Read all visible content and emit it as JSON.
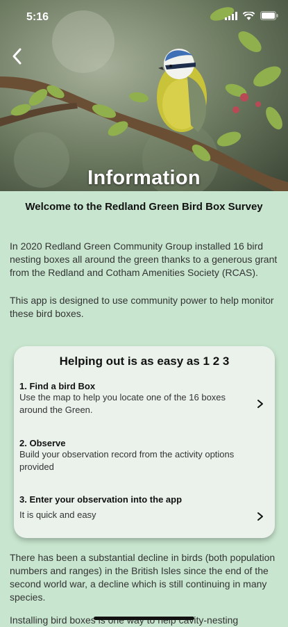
{
  "status_bar": {
    "time": "5:16"
  },
  "hero": {
    "title": "Information"
  },
  "intro": {
    "heading": "Welcome to the Redland Green Bird Box Survey",
    "paragraph1": "In 2020 Redland Green Community Group installed 16 bird nesting boxes all around the green thanks to a generous grant from the Redland and Cotham Amenities Society (RCAS).",
    "paragraph2": "This app is designed to use community power to help monitor these bird boxes."
  },
  "card": {
    "title": "Helping out is as easy as 1 2 3",
    "steps": [
      {
        "title": "1. Find a bird Box",
        "text": "Use the map to help you locate one of the 16 boxes around the Green."
      },
      {
        "title": "2. Observe",
        "text": "Build your observation record from the activity options provided"
      },
      {
        "title": "3. Enter your observation into the app",
        "text": "It is quick and easy"
      }
    ]
  },
  "body": {
    "paragraph3": "There has been a substantial decline in birds (both population numbers and ranges) in the British Isles since the end of the second world war, a decline which is still continuing in many species.",
    "paragraph4": "Installing bird boxes is one way to help cavity-nesting"
  },
  "colors": {
    "background": "#c8e6cf",
    "card": "#eaf2eb"
  },
  "icons": [
    "back-chevron-icon",
    "chevron-right-icon",
    "wifi-icon",
    "battery-icon",
    "signal-icon"
  ]
}
